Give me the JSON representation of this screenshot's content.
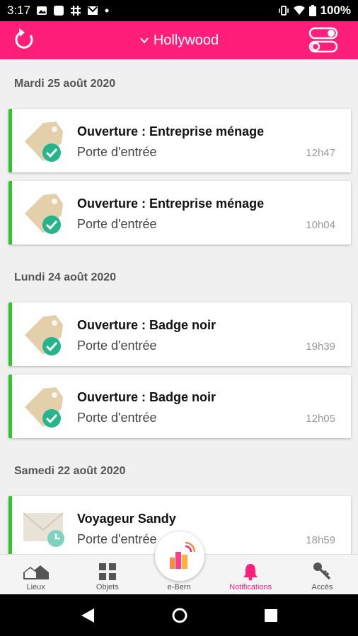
{
  "status": {
    "time": "3:17",
    "battery": "100%"
  },
  "header": {
    "location": "Hollywood"
  },
  "sections": [
    {
      "date": "Mardi 25 août 2020",
      "items": [
        {
          "title": "Ouverture : Entreprise ménage",
          "subtitle": "Porte d'entrée",
          "time": "12h47",
          "icon": "tag-check-icon"
        },
        {
          "title": "Ouverture : Entreprise ménage",
          "subtitle": "Porte d'entrée",
          "time": "10h04",
          "icon": "tag-check-icon"
        }
      ]
    },
    {
      "date": "Lundi 24 août 2020",
      "items": [
        {
          "title": "Ouverture : Badge noir",
          "subtitle": "Porte d'entrée",
          "time": "19h39",
          "icon": "tag-check-icon"
        },
        {
          "title": "Ouverture : Badge noir",
          "subtitle": "Porte d'entrée",
          "time": "12h05",
          "icon": "tag-check-icon"
        }
      ]
    },
    {
      "date": "Samedi 22 août 2020",
      "items": [
        {
          "title": "Voyageur Sandy",
          "subtitle": "Porte d'entrée",
          "time": "18h59",
          "icon": "envelope-clock-icon"
        }
      ]
    }
  ],
  "nav": [
    {
      "label": "Lieux",
      "icon": "houses-icon"
    },
    {
      "label": "Objets",
      "icon": "grid-icon"
    },
    {
      "label": "e-Bern",
      "icon": "ebern-logo-icon"
    },
    {
      "label": "Notifications",
      "icon": "bell-icon",
      "active": true
    },
    {
      "label": "Accès",
      "icon": "key-icon"
    }
  ],
  "colors": {
    "primary": "#ff1f7b",
    "accent_green": "#2ec82e",
    "check_green": "#26b48c",
    "tag": "#e3cfa9"
  }
}
